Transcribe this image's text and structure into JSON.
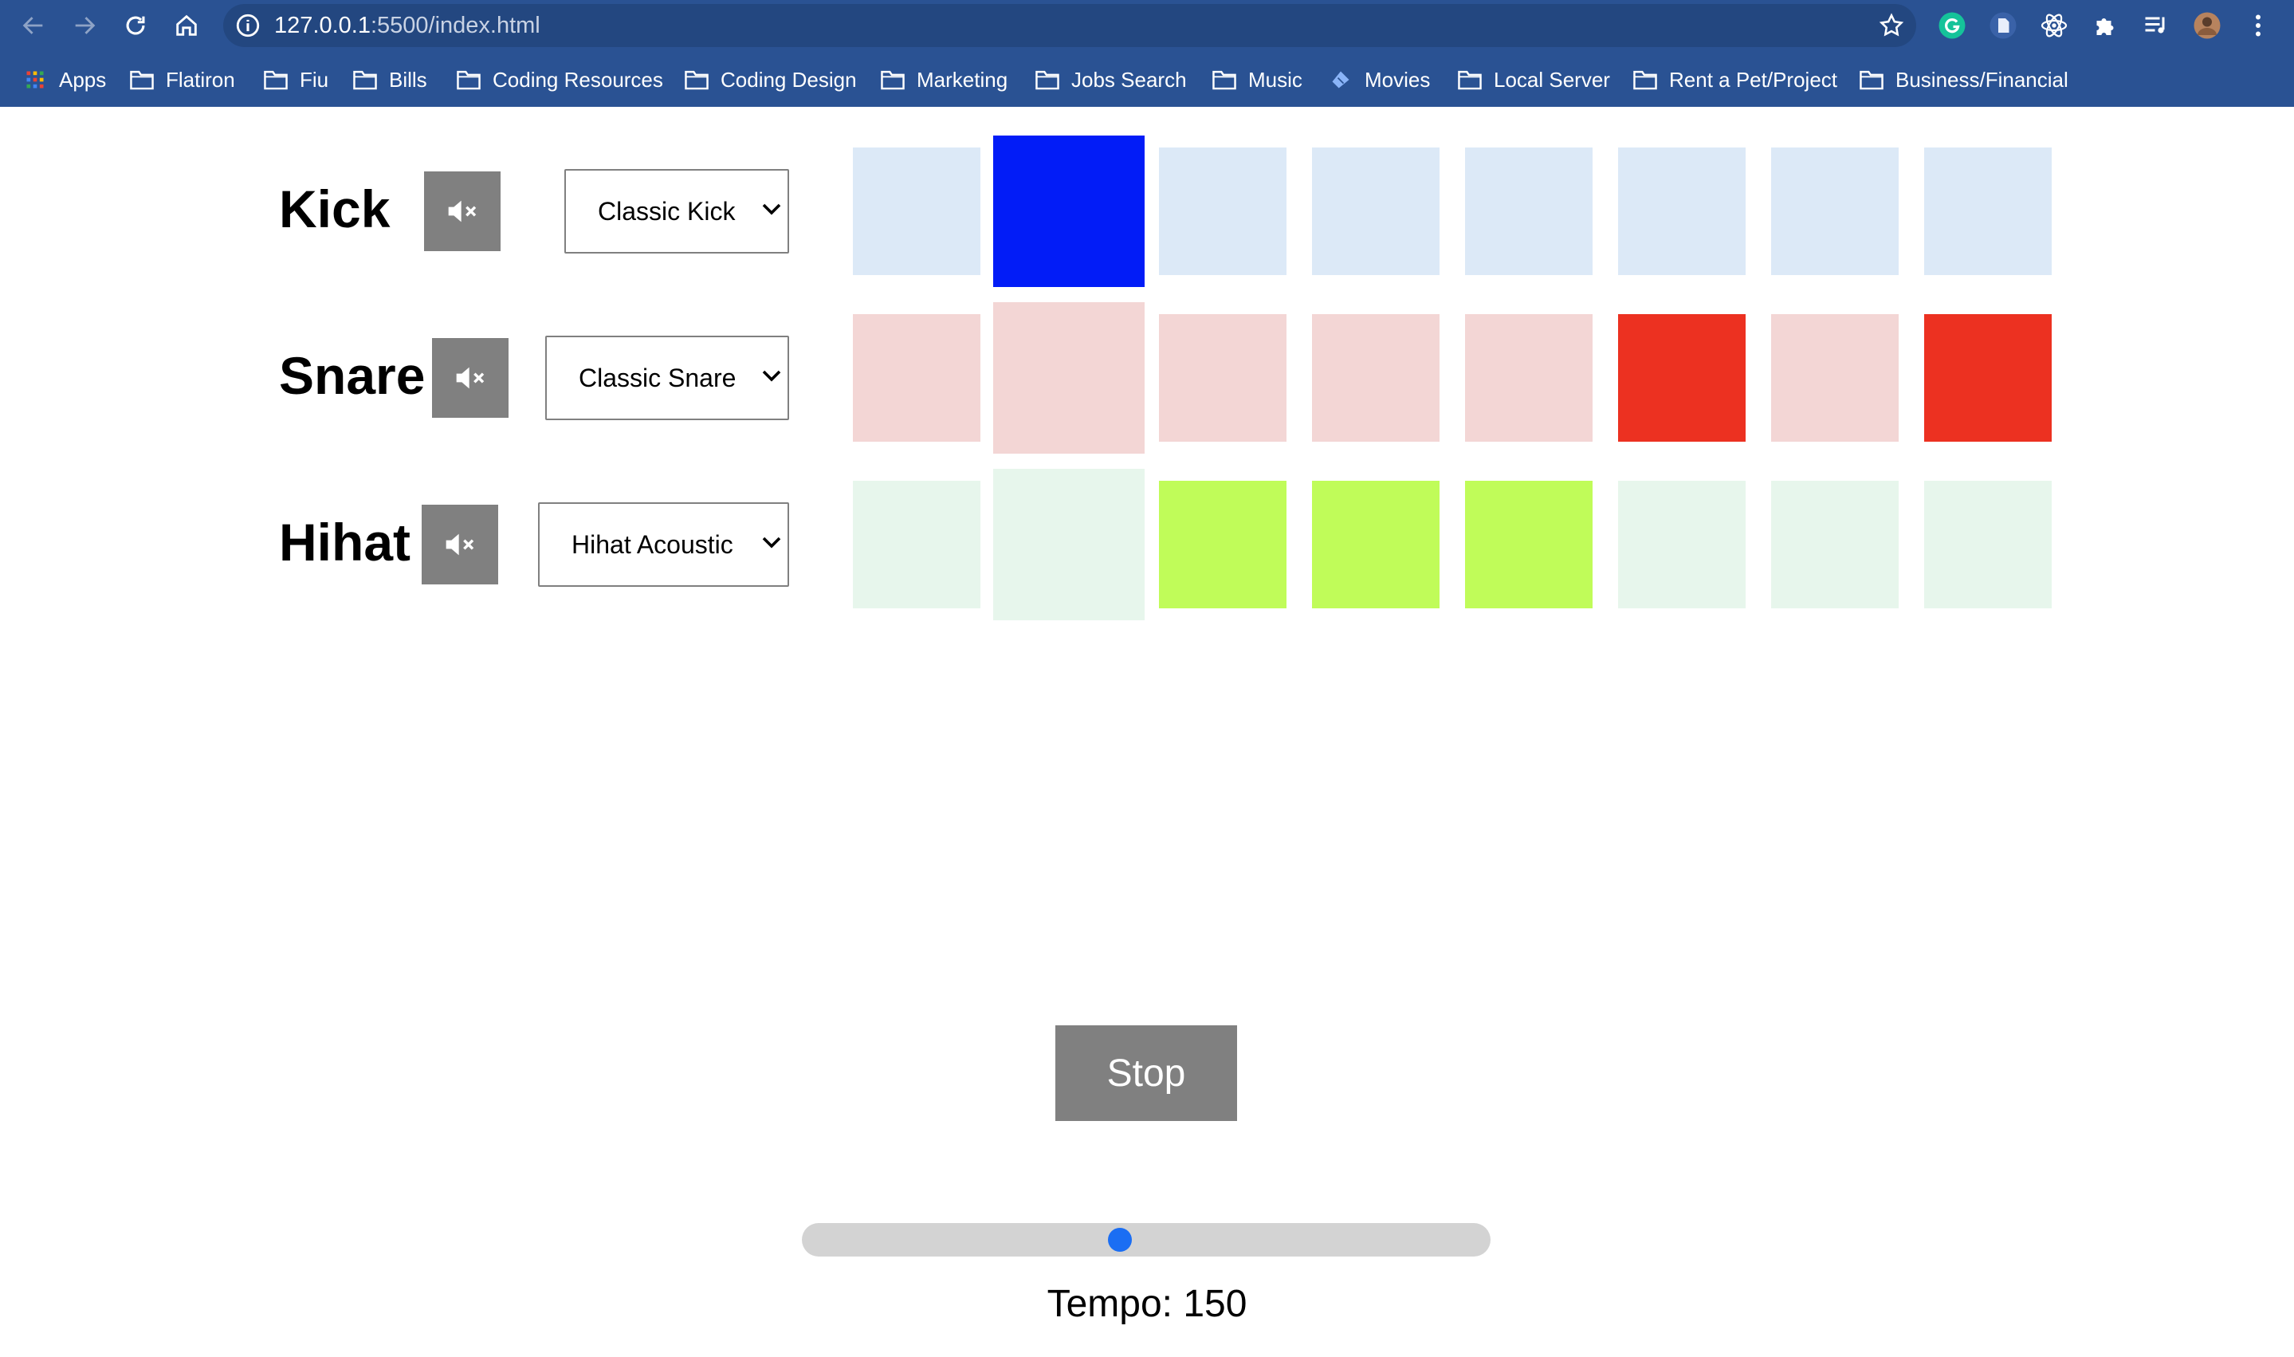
{
  "browser": {
    "url_host": "127.0.0.1",
    "url_path": ":5500/index.html",
    "bookmarks": [
      {
        "label": "Apps",
        "icon": "apps-grid-icon"
      },
      {
        "label": "Flatiron",
        "icon": "folder-icon"
      },
      {
        "label": "Fiu",
        "icon": "folder-icon"
      },
      {
        "label": "Bills",
        "icon": "folder-icon"
      },
      {
        "label": "Coding Resources",
        "icon": "folder-icon"
      },
      {
        "label": "Coding Design",
        "icon": "folder-icon"
      },
      {
        "label": "Marketing",
        "icon": "folder-icon"
      },
      {
        "label": "Jobs Search",
        "icon": "folder-icon"
      },
      {
        "label": "Music",
        "icon": "folder-icon"
      },
      {
        "label": "Movies",
        "icon": "ticket-icon"
      },
      {
        "label": "Local Server",
        "icon": "folder-icon"
      },
      {
        "label": "Rent a Pet/Project",
        "icon": "folder-icon"
      },
      {
        "label": "Business/Financial",
        "icon": "folder-icon"
      }
    ]
  },
  "tracks": [
    {
      "name": "Kick",
      "sound": "Classic Kick",
      "mute_icon": "volume-mute-icon",
      "pad_color_off": "#dce9f7",
      "pad_color_on": "#021cf7",
      "pads_active": [
        false,
        true,
        false,
        false,
        false,
        false,
        false,
        false
      ]
    },
    {
      "name": "Snare",
      "sound": "Classic Snare",
      "mute_icon": "volume-mute-icon",
      "pad_color_off": "#f3d6d5",
      "pad_color_on": "#ec3121",
      "pads_active": [
        false,
        false,
        false,
        false,
        false,
        true,
        false,
        true
      ]
    },
    {
      "name": "Hihat",
      "sound": "Hihat Acoustic",
      "mute_icon": "volume-mute-icon",
      "pad_color_off": "#e7f6ec",
      "pad_color_on": "#c0fc59",
      "pads_active": [
        false,
        false,
        true,
        true,
        true,
        false,
        false,
        false
      ]
    }
  ],
  "current_step": 2,
  "controls": {
    "stop_label": "Stop",
    "tempo_text": "Tempo: 150",
    "tempo_value": 150,
    "tempo_fraction": 0.46
  },
  "colors": {
    "chrome_bg": "#2a5293",
    "button_gray": "#808080",
    "slider_thumb": "#1b6ef3"
  }
}
